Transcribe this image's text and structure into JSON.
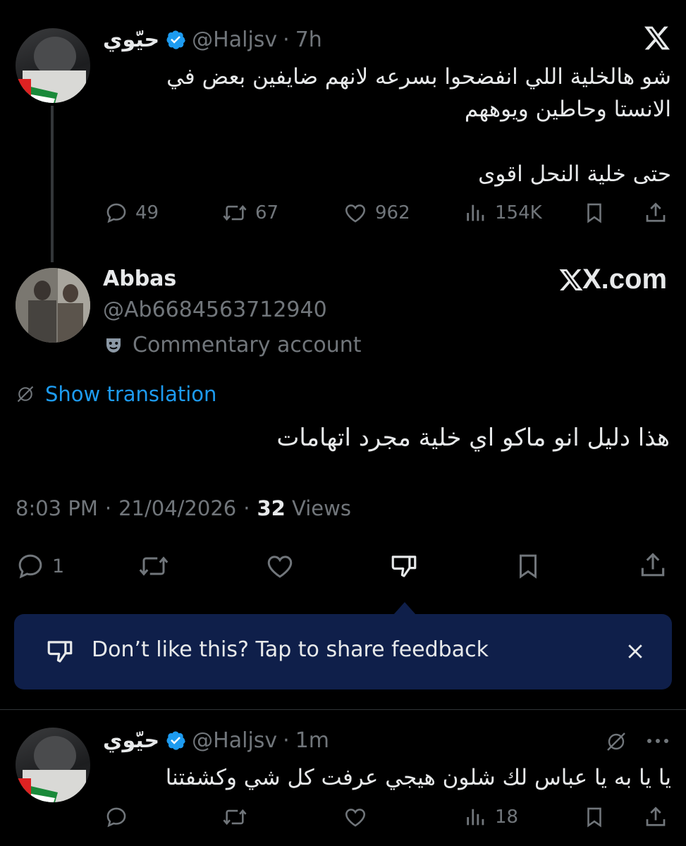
{
  "tweet1": {
    "name": "حيّوي",
    "handle": "@Haljsv",
    "dot": "·",
    "time": "7h",
    "line1": "شو هالخلية اللي انفضحوا بسرعه لانهم ضايفين بعض في",
    "line2": "الانستا وحاطين ويوههم",
    "line3": "حتى خلية النحل اقوى",
    "replies": "49",
    "reposts": "67",
    "likes": "962",
    "views": "154K"
  },
  "main_tweet": {
    "name": "Abbas",
    "handle": "@Ab6684563712940",
    "account_label": "Commentary account",
    "watermark": "X.com",
    "show_translation": "Show translation",
    "text": "هذا دليل انو ماكو اي خلية مجرد اتهامات",
    "time": "8:03 PM",
    "sep1": "·",
    "date": "21/04/2026",
    "sep2": "·",
    "views_count": "32",
    "views_label": "Views",
    "replies": "1"
  },
  "feedback": {
    "text": "Don’t like this? Tap to share feedback"
  },
  "reply": {
    "name": "حيّوي",
    "handle": "@Haljsv",
    "dot": "·",
    "time": "1m",
    "text": "يا يا به يا عباس لك شلون هيجي عرفت كل شي وكشفتنا",
    "views": "18"
  },
  "colors": {
    "accent": "#1d9bf0",
    "feedback_bg": "#0f1f4a",
    "muted": "#71767b",
    "text": "#e7e9ea"
  }
}
